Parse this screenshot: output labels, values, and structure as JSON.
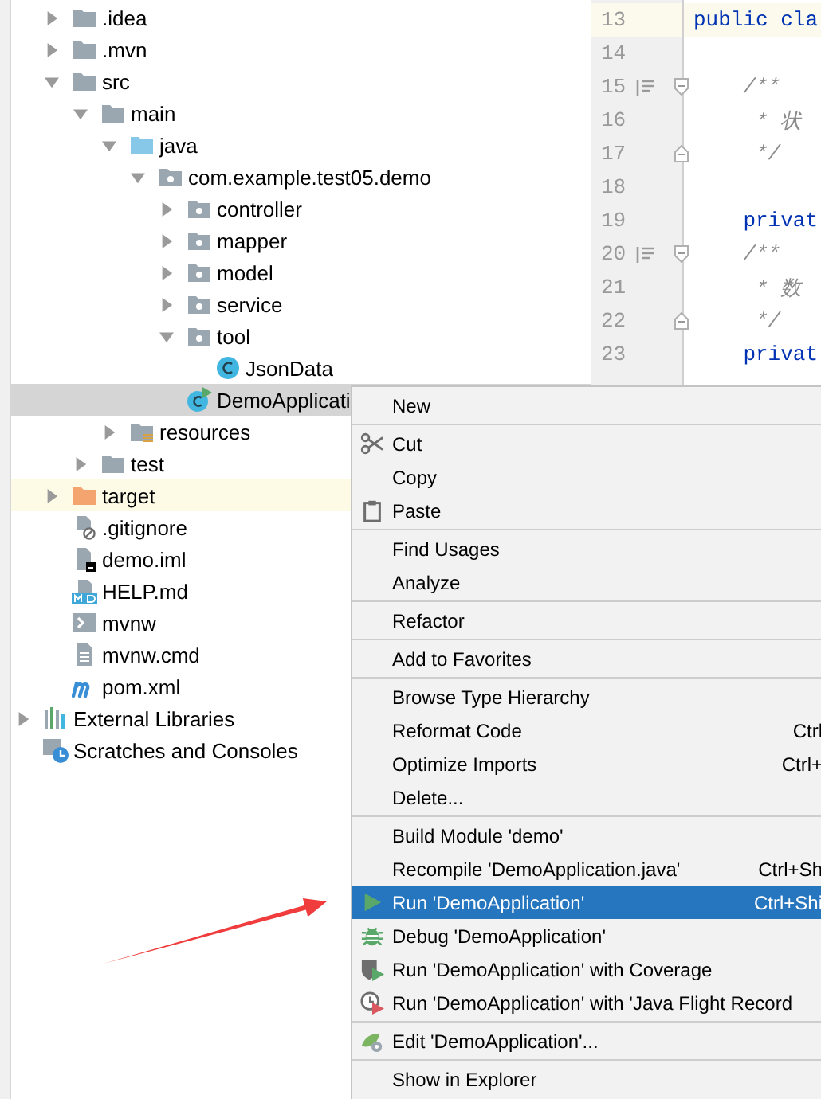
{
  "project_tree": {
    "items": [
      {
        "label": ".idea",
        "kind": "folder",
        "expanded": false,
        "selected": false,
        "highlighted": false
      },
      {
        "label": ".mvn",
        "kind": "folder",
        "expanded": false,
        "selected": false,
        "highlighted": false
      },
      {
        "label": "src",
        "kind": "folder",
        "expanded": true,
        "selected": false,
        "highlighted": false,
        "children": [
          {
            "label": "main",
            "kind": "folder",
            "expanded": true,
            "selected": false,
            "highlighted": false,
            "children": [
              {
                "label": "java",
                "kind": "source-folder",
                "expanded": true,
                "selected": false,
                "highlighted": false,
                "children": [
                  {
                    "label": "com.example.test05.demo",
                    "kind": "package",
                    "expanded": true,
                    "selected": false,
                    "highlighted": false,
                    "children": [
                      {
                        "label": "controller",
                        "kind": "package",
                        "expanded": false,
                        "selected": false,
                        "highlighted": false
                      },
                      {
                        "label": "mapper",
                        "kind": "package",
                        "expanded": false,
                        "selected": false,
                        "highlighted": false
                      },
                      {
                        "label": "model",
                        "kind": "package",
                        "expanded": false,
                        "selected": false,
                        "highlighted": false
                      },
                      {
                        "label": "service",
                        "kind": "package",
                        "expanded": false,
                        "selected": false,
                        "highlighted": false
                      },
                      {
                        "label": "tool",
                        "kind": "package",
                        "expanded": true,
                        "selected": false,
                        "highlighted": false,
                        "children": [
                          {
                            "label": "JsonData",
                            "kind": "class",
                            "selected": false,
                            "highlighted": false
                          }
                        ]
                      },
                      {
                        "label": "DemoApplicati",
                        "kind": "spring-class",
                        "selected": true,
                        "highlighted": false
                      }
                    ]
                  }
                ]
              },
              {
                "label": "resources",
                "kind": "resource-folder",
                "expanded": false,
                "selected": false,
                "highlighted": false
              }
            ]
          },
          {
            "label": "test",
            "kind": "folder",
            "expanded": false,
            "selected": false,
            "highlighted": false
          }
        ]
      },
      {
        "label": "target",
        "kind": "excluded-folder",
        "expanded": false,
        "selected": false,
        "highlighted": true
      },
      {
        "label": ".gitignore",
        "kind": "gitignore",
        "selected": false,
        "highlighted": false
      },
      {
        "label": "demo.iml",
        "kind": "iml",
        "selected": false,
        "highlighted": false
      },
      {
        "label": "HELP.md",
        "kind": "markdown",
        "selected": false,
        "highlighted": false
      },
      {
        "label": "mvnw",
        "kind": "script",
        "selected": false,
        "highlighted": false
      },
      {
        "label": "mvnw.cmd",
        "kind": "text-file",
        "selected": false,
        "highlighted": false
      },
      {
        "label": "pom.xml",
        "kind": "maven",
        "selected": false,
        "highlighted": false
      }
    ]
  },
  "other_nodes": [
    {
      "label": "External Libraries",
      "kind": "libraries",
      "expanded": false,
      "selected": false,
      "highlighted": false
    },
    {
      "label": "Scratches and Consoles",
      "kind": "scratches",
      "selected": false,
      "highlighted": false
    }
  ],
  "editor": {
    "lines": [
      {
        "number": "13",
        "code": "public cla",
        "kind": "code",
        "current": true,
        "marker": false,
        "fold_start": false,
        "fold_end": false
      },
      {
        "number": "14",
        "kind": "blank",
        "current": false,
        "marker": false,
        "fold_start": false,
        "fold_end": false
      },
      {
        "number": "15",
        "code": "    /**",
        "kind": "comment",
        "current": false,
        "marker": true,
        "fold_start": true,
        "fold_end": false
      },
      {
        "number": "16",
        "code": "     * 状",
        "kind": "comment",
        "current": false,
        "marker": false,
        "fold_start": false,
        "fold_end": false
      },
      {
        "number": "17",
        "code": "     */",
        "kind": "comment",
        "current": false,
        "marker": false,
        "fold_start": false,
        "fold_end": true
      },
      {
        "number": "18",
        "kind": "blank",
        "current": false,
        "marker": false,
        "fold_start": false,
        "fold_end": false
      },
      {
        "number": "19",
        "code": "    privat",
        "kind": "code",
        "current": false,
        "marker": false,
        "fold_start": false,
        "fold_end": false
      },
      {
        "number": "20",
        "code": "    /**",
        "kind": "comment",
        "current": false,
        "marker": true,
        "fold_start": true,
        "fold_end": false
      },
      {
        "number": "21",
        "code": "     * 数",
        "kind": "comment",
        "current": false,
        "marker": false,
        "fold_start": false,
        "fold_end": false
      },
      {
        "number": "22",
        "code": "     */",
        "kind": "comment",
        "current": false,
        "marker": false,
        "fold_start": false,
        "fold_end": true
      },
      {
        "number": "23",
        "code": "    privat",
        "kind": "code",
        "current": false,
        "marker": false,
        "fold_start": false,
        "fold_end": false
      }
    ]
  },
  "context_menu": {
    "items": [
      {
        "kind": "plain",
        "label": "New",
        "selected": false
      },
      {
        "kind": "separator"
      },
      {
        "kind": "cut",
        "label": "Cut",
        "selected": false
      },
      {
        "kind": "plain",
        "label": "Copy",
        "selected": false
      },
      {
        "kind": "paste",
        "label": "Paste",
        "selected": false
      },
      {
        "kind": "separator"
      },
      {
        "kind": "plain",
        "label": "Find Usages",
        "selected": false
      },
      {
        "kind": "plain",
        "label": "Analyze",
        "selected": false
      },
      {
        "kind": "separator"
      },
      {
        "kind": "plain",
        "label": "Refactor",
        "selected": false
      },
      {
        "kind": "separator"
      },
      {
        "kind": "plain",
        "label": "Add to Favorites",
        "selected": false
      },
      {
        "kind": "separator"
      },
      {
        "kind": "plain",
        "label": "Browse Type Hierarchy",
        "selected": false
      },
      {
        "kind": "plain",
        "label": "Reformat Code",
        "shortcut": "Ctrl",
        "selected": false
      },
      {
        "kind": "plain",
        "label": "Optimize Imports",
        "shortcut": "Ctrl+",
        "selected": false
      },
      {
        "kind": "plain",
        "label": "Delete...",
        "selected": false
      },
      {
        "kind": "separator"
      },
      {
        "kind": "plain",
        "label": "Build Module 'demo'",
        "selected": false
      },
      {
        "kind": "plain",
        "label": "Recompile 'DemoApplication.java'",
        "shortcut": "Ctrl+Sh",
        "selected": false
      },
      {
        "kind": "run",
        "label": "Run 'DemoApplication'",
        "shortcut": "Ctrl+Shi",
        "selected": true
      },
      {
        "kind": "debug",
        "label": "Debug 'DemoApplication'",
        "selected": false
      },
      {
        "kind": "coverage",
        "label": "Run 'DemoApplication' with Coverage",
        "selected": false
      },
      {
        "kind": "profile",
        "label": "Run 'DemoApplication' with 'Java Flight Record",
        "selected": false
      },
      {
        "kind": "separator"
      },
      {
        "kind": "edit",
        "label": "Edit 'DemoApplication'...",
        "selected": false
      },
      {
        "kind": "separator"
      },
      {
        "kind": "plain",
        "label": "Show in Explorer",
        "selected": false
      }
    ]
  }
}
